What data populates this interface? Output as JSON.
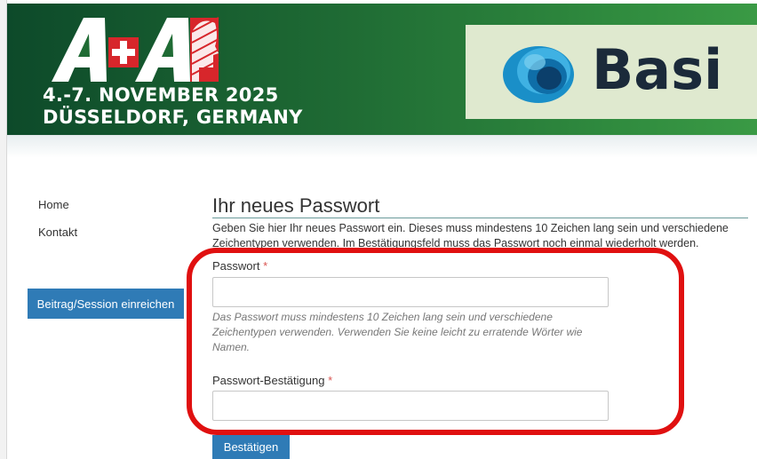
{
  "banner": {
    "event_logo_text": "A+A",
    "event_date": "4.-7. NOVEMBER 2025",
    "event_place": "DÜSSELDORF, GERMANY",
    "sponsor_name": "Basi"
  },
  "sidebar": {
    "items": [
      {
        "label": "Home"
      },
      {
        "label": "Kontakt"
      }
    ],
    "submit_label": "Beitrag/Session einreichen"
  },
  "main": {
    "title": "Ihr neues Passwort",
    "intro": "Geben Sie hier Ihr neues Passwort ein. Dieses muss mindestens 10 Zeichen lang sein und verschiedene Zeichentypen verwenden. Im Bestätigungsfeld muss das Passwort noch einmal wiederholt werden.",
    "password": {
      "label": "Passwort",
      "required_mark": "*",
      "value": "",
      "help": "Das Passwort muss mindestens 10 Zeichen lang sein und verschiedene Zeichentypen verwenden. Verwenden Sie keine leicht zu erratende Wörter wie Namen."
    },
    "password_confirm": {
      "label": "Passwort-Bestätigung",
      "required_mark": "*",
      "value": ""
    },
    "confirm_label": "Bestätigen"
  },
  "colors": {
    "banner_green": "#1f6b34",
    "button_blue": "#2f7bb6",
    "annotation_red": "#e01010",
    "required_red": "#d9534f"
  }
}
